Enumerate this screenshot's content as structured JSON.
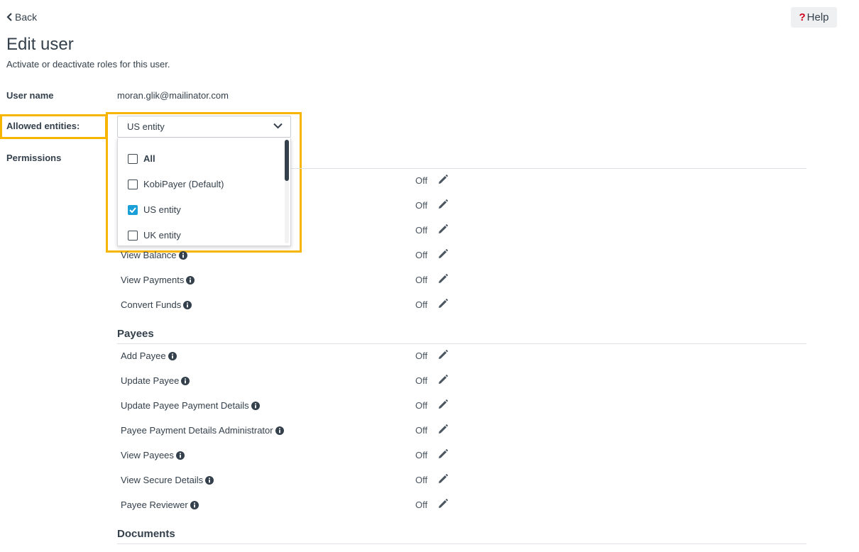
{
  "nav": {
    "back_label": "Back",
    "help_label": "Help"
  },
  "page": {
    "title": "Edit user",
    "subtitle": "Activate or deactivate roles for this user."
  },
  "form": {
    "username_label": "User name",
    "username_value": "moran.glik@mailinator.com",
    "entities_label": "Allowed entities:",
    "permissions_label": "Permissions",
    "entities_select": {
      "selected": "US entity",
      "options": [
        {
          "label": "All",
          "checked": false
        },
        {
          "label": "KobiPayer (Default)",
          "checked": false
        },
        {
          "label": "US entity",
          "checked": true
        },
        {
          "label": "UK entity",
          "checked": false
        }
      ]
    }
  },
  "permission_groups": [
    {
      "rows": [
        {
          "label": "",
          "status": "Off"
        },
        {
          "label": "",
          "status": "Off"
        },
        {
          "label": "",
          "status": "Off"
        },
        {
          "label": "View Balance",
          "status": "Off"
        },
        {
          "label": "View Payments",
          "status": "Off"
        },
        {
          "label": "Convert Funds",
          "status": "Off"
        }
      ]
    },
    {
      "title": "Payees",
      "rows": [
        {
          "label": "Add Payee",
          "status": "Off"
        },
        {
          "label": "Update Payee",
          "status": "Off"
        },
        {
          "label": "Update Payee Payment Details",
          "status": "Off"
        },
        {
          "label": "Payee Payment Details Administrator",
          "status": "Off"
        },
        {
          "label": "View Payees",
          "status": "Off"
        },
        {
          "label": "View Secure Details",
          "status": "Off"
        },
        {
          "label": "Payee Reviewer",
          "status": "Off"
        }
      ]
    },
    {
      "title": "Documents",
      "rows": []
    }
  ],
  "colors": {
    "highlight": "#f7b500",
    "checkbox_checked": "#1a9fd6",
    "text": "#34404b",
    "help_icon": "#d0021b"
  },
  "icons": {
    "back": "chevron-left-icon",
    "help": "question-mark-icon",
    "select": "chevron-down-icon",
    "info": "info-circle-icon",
    "edit": "pencil-icon"
  }
}
